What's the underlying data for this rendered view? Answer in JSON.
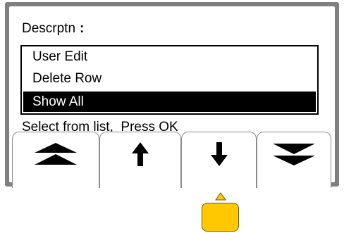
{
  "screen": {
    "title": "Descrptn",
    "title_colon": ":",
    "list_items": [
      {
        "label": "User Edit",
        "selected": false
      },
      {
        "label": "Delete Row",
        "selected": false
      },
      {
        "label": "Show All",
        "selected": true
      }
    ],
    "status_text": "Select from list,  Press OK"
  },
  "softkeys": [
    {
      "icon": "double-up-chevron-icon"
    },
    {
      "icon": "up-arrow-icon"
    },
    {
      "icon": "down-arrow-icon"
    },
    {
      "icon": "double-down-chevron-icon"
    }
  ],
  "ok_button": {
    "indicator_icon": "up-triangle-icon"
  },
  "colors": {
    "bezel": "#7f7f7f",
    "selection": "#000000",
    "ok_key": "#ffc800"
  }
}
